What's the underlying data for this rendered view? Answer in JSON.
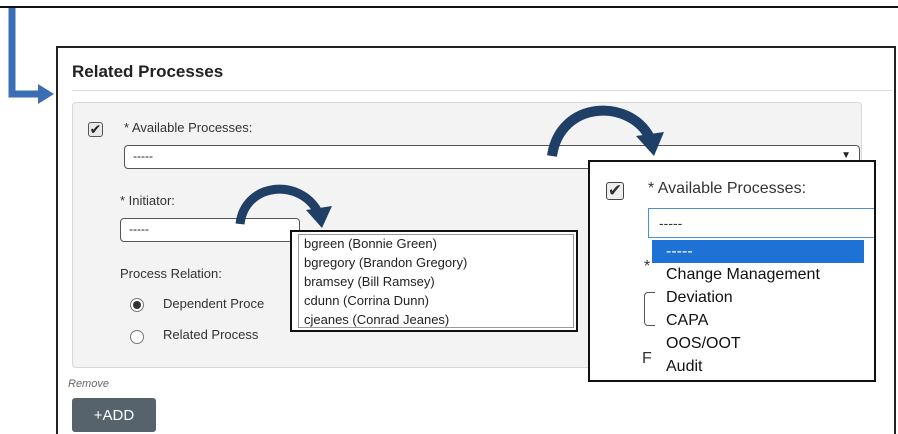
{
  "section": {
    "title": "Related Processes"
  },
  "form": {
    "available_processes_label": "* Available Processes:",
    "available_processes_value": "-----",
    "initiator_label": "* Initiator:",
    "initiator_value": "-----",
    "process_relation_label": "Process Relation:",
    "relation_options": [
      {
        "label": "Dependent Proce",
        "checked": true
      },
      {
        "label": "Related Process",
        "checked": false
      }
    ]
  },
  "initiator_dropdown": {
    "options": [
      "bgreen (Bonnie Green)",
      "bgregory (Brandon Gregory)",
      "bramsey (Bill Ramsey)",
      "cdunn (Corrina Dunn)",
      "cjeanes (Conrad Jeanes)"
    ]
  },
  "zoom": {
    "label": "* Available Processes:",
    "select_value": "-----",
    "options": [
      "-----",
      "Change Management",
      "Deviation",
      "CAPA",
      "OOS/OOT",
      "Audit"
    ],
    "selected_index": 0
  },
  "actions": {
    "remove_label": "Remove",
    "add_label": "+ADD"
  },
  "colors": {
    "arrow": "#3b6fb5",
    "curve": "#1f3f66",
    "add_button": "#56636c",
    "selected_option": "#1e72d6"
  }
}
